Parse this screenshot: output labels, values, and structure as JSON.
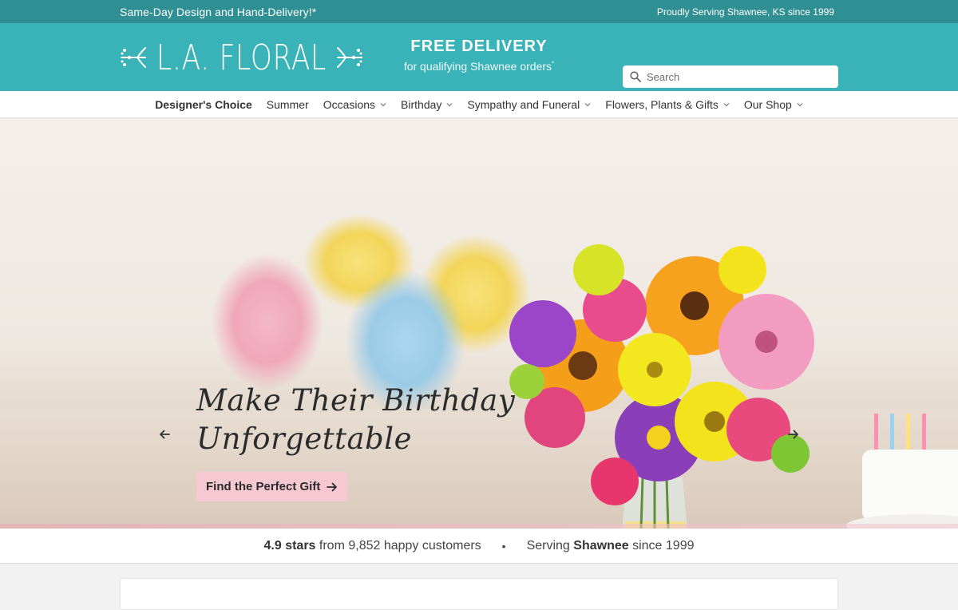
{
  "topbar": {
    "left_text": "Same-Day Design and Hand-Delivery!*",
    "right_text": "Proudly Serving Shawnee, KS since 1999"
  },
  "header": {
    "logo_text": "L.A. FLORAL",
    "promo_title": "FREE DELIVERY",
    "promo_sub": "for qualifying Shawnee orders",
    "promo_mark": "*",
    "search_placeholder": "Search",
    "search_icon": "search-icon"
  },
  "nav": {
    "items": [
      {
        "label": "Designer's Choice",
        "dropdown": false
      },
      {
        "label": "Summer",
        "dropdown": false
      },
      {
        "label": "Occasions",
        "dropdown": true
      },
      {
        "label": "Birthday",
        "dropdown": true
      },
      {
        "label": "Sympathy and Funeral",
        "dropdown": true
      },
      {
        "label": "Flowers, Plants & Gifts",
        "dropdown": true
      },
      {
        "label": "Our Shop",
        "dropdown": true
      }
    ]
  },
  "hero": {
    "headline_line1": "Make Their Birthday",
    "headline_line2": "Unforgettable",
    "cta_label": "Find the Perfect Gift",
    "cta_icon": "arrow-right-icon",
    "prev_icon": "arrow-left-icon",
    "next_icon": "arrow-right-icon",
    "slides_total": 3,
    "active_slide": 1
  },
  "ratings": {
    "stars": "4.9 stars",
    "from_text": "from 9,852 happy customers",
    "bullet": "•",
    "serving_prefix": "Serving",
    "city": "Shawnee",
    "serving_suffix": "since 1999"
  },
  "colors": {
    "topbar": "#2f8f93",
    "header": "#39b3b8",
    "cta": "#f6c8d2"
  }
}
